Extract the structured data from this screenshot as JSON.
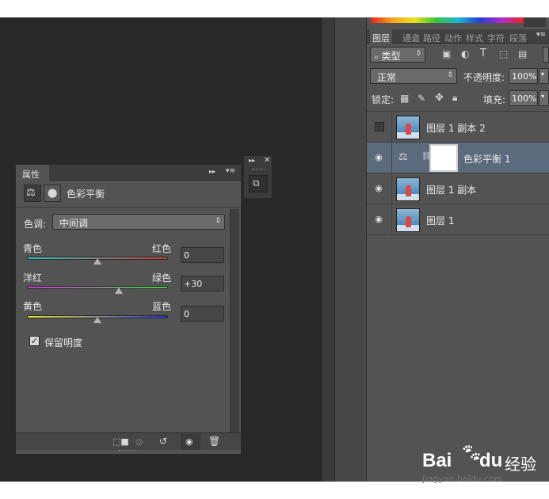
{
  "layers_panel": {
    "tabs": [
      {
        "label": "图层",
        "active": true
      },
      {
        "label": "通道"
      },
      {
        "label": "路径"
      },
      {
        "label": "动作"
      },
      {
        "label": "样式"
      },
      {
        "label": "字符"
      },
      {
        "label": "段落"
      }
    ],
    "filter": {
      "icon": "search-icon",
      "value": "类型"
    },
    "blend_mode": "正常",
    "opacity_label": "不透明度:",
    "opacity_value": "100%",
    "lock_label": "锁定:",
    "fill_label": "填充:",
    "fill_value": "100%",
    "layers": [
      {
        "name": "图层 1 副本 2",
        "visible": false,
        "kind": "image"
      },
      {
        "name": "色彩平衡 1",
        "visible": true,
        "kind": "adjustment",
        "selected": true
      },
      {
        "name": "图层 1 副本",
        "visible": true,
        "kind": "image"
      },
      {
        "name": "图层 1",
        "visible": true,
        "kind": "image"
      }
    ]
  },
  "properties_panel": {
    "tab_label": "属性",
    "title": "色彩平衡",
    "tone_label": "色调:",
    "tone_value": "中间调",
    "sliders": [
      {
        "left": "青色",
        "right": "红色",
        "value": "0",
        "position": 0.5,
        "colors": [
          "#2ec4c4",
          "#d33a3a"
        ]
      },
      {
        "left": "洋红",
        "right": "绿色",
        "value": "+30",
        "position": 0.65,
        "colors": [
          "#c93ad1",
          "#3fcf3f"
        ]
      },
      {
        "left": "黄色",
        "right": "蓝色",
        "value": "0",
        "position": 0.5,
        "colors": [
          "#e4e23a",
          "#2a33c9"
        ]
      }
    ],
    "preserve_luminosity_label": "保留明度",
    "preserve_luminosity_checked": true
  },
  "watermark": {
    "brand": "Bai",
    "brand2": "du",
    "suffix": "经验",
    "url": "jingyan.baidu.com"
  }
}
